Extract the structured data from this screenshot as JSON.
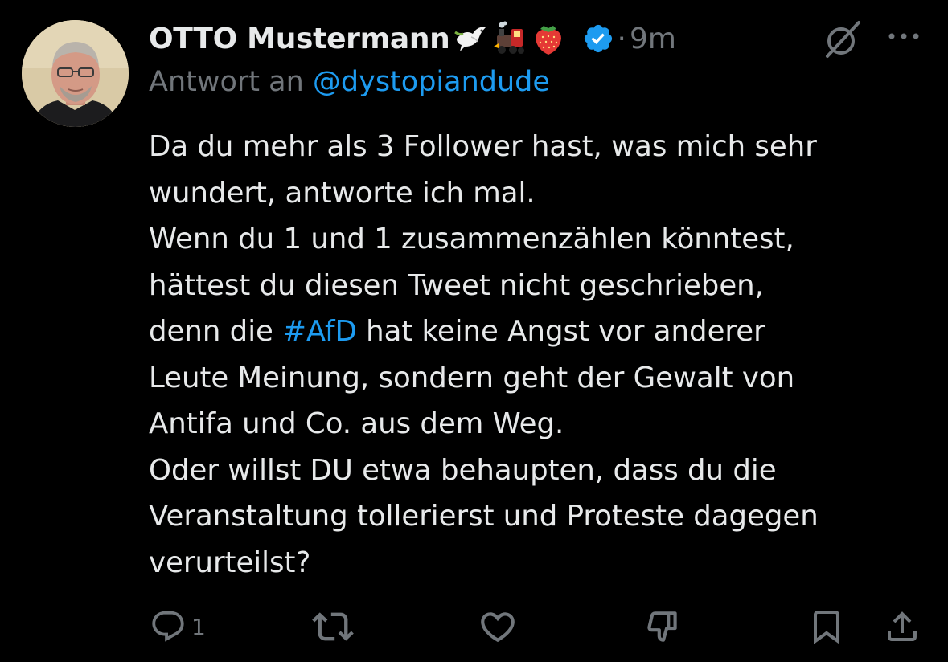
{
  "author": {
    "name": "OTTO Mustermann",
    "emojis": [
      "dove-icon",
      "locomotive-icon",
      "strawberry-icon"
    ],
    "verified_icon": "verified-badge-icon",
    "separator": "·",
    "time": "9m"
  },
  "reply": {
    "prefix": "Antwort an",
    "handle": "@dystopiandude"
  },
  "tweet": {
    "lines": [
      "Da du mehr als 3 Follower hast, was mich sehr",
      "wundert, antworte ich mal.",
      "Wenn du 1 und 1 zusammenzählen könntest,",
      "hättest du diesen Tweet nicht geschrieben,"
    ],
    "line5_before": "denn die ",
    "hashtag": "#AfD",
    "line5_after": " hat keine Angst vor anderer",
    "lines_rest": [
      "Leute Meinung, sondern geht der Gewalt von",
      "Antifa und Co. aus dem Weg.",
      "Oder willst DU etwa behaupten, dass du die",
      "Veranstaltung tollerierst und Proteste dagegen",
      "verurteilst?"
    ]
  },
  "actions": {
    "reply_count": "1",
    "icons": [
      "reply-icon",
      "repost-icon",
      "like-icon",
      "downvote-icon",
      "bookmark-icon",
      "share-icon"
    ]
  },
  "colors": {
    "background": "#000000",
    "text": "#e7e9ea",
    "secondary": "#71767b",
    "accent": "#1d9bf0"
  }
}
